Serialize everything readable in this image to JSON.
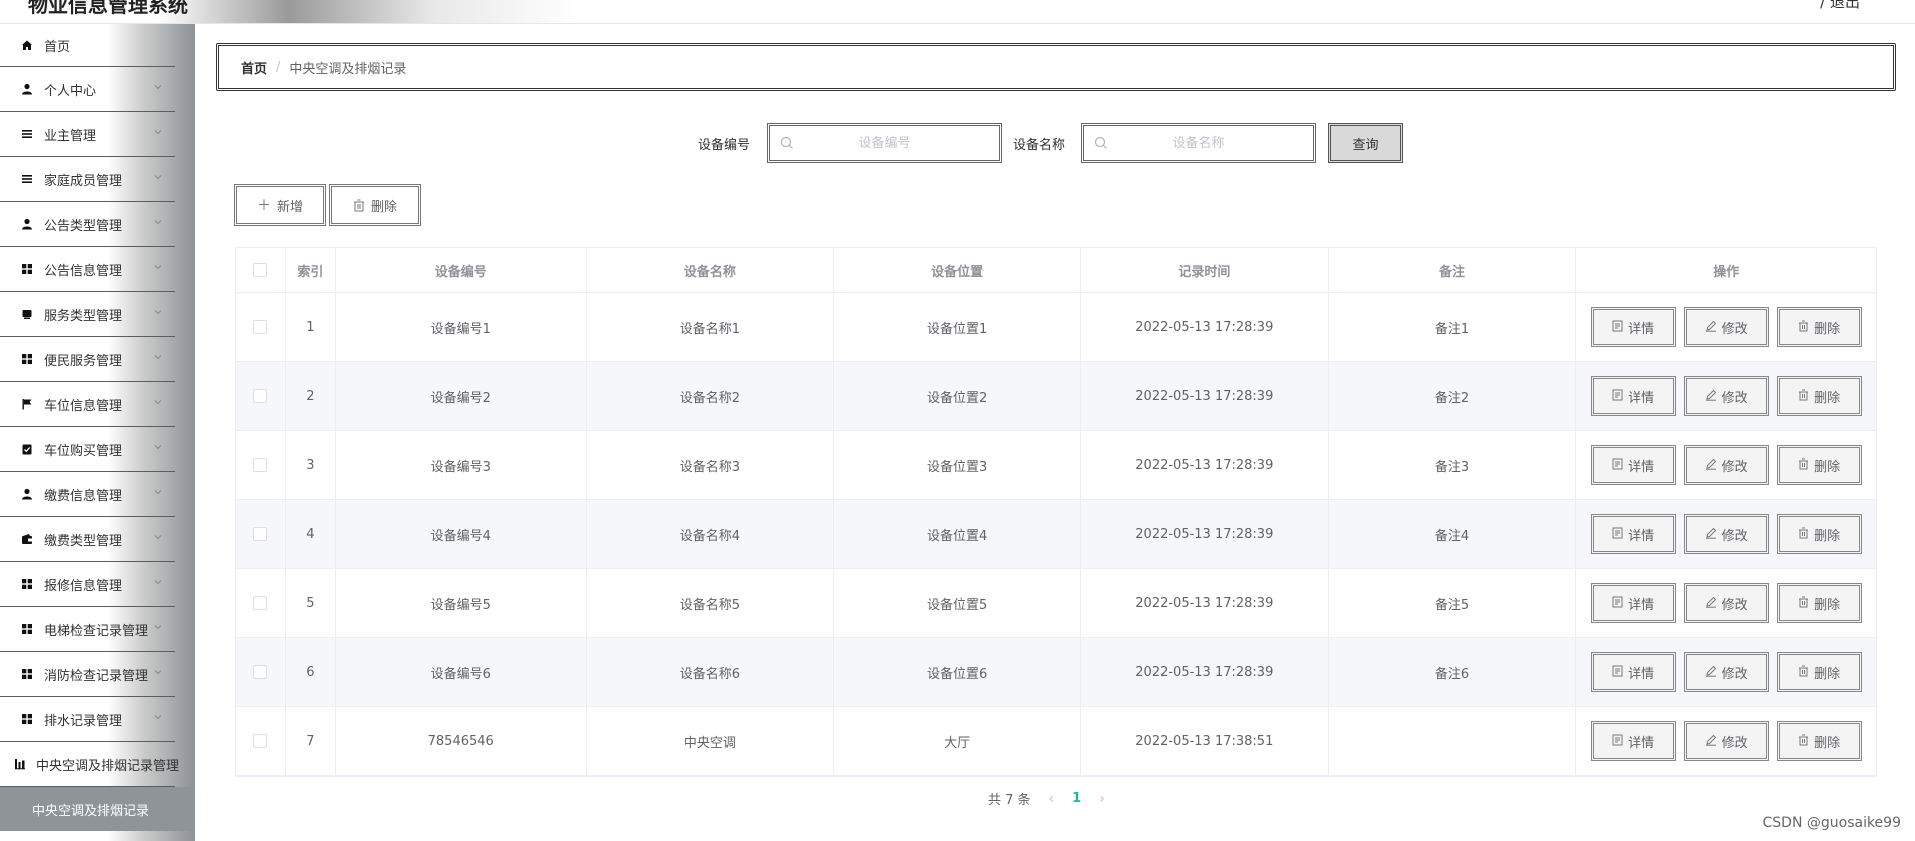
{
  "app": {
    "title": "物业信息管理系统",
    "top_right": "/ 退出"
  },
  "sidebar": {
    "items": [
      {
        "label": "首页",
        "icon": "home-icon"
      },
      {
        "label": "个人中心",
        "icon": "user-icon"
      },
      {
        "label": "业主管理",
        "icon": "list-icon"
      },
      {
        "label": "家庭成员管理",
        "icon": "list-icon"
      },
      {
        "label": "公告类型管理",
        "icon": "user-icon"
      },
      {
        "label": "公告信息管理",
        "icon": "grid-icon"
      },
      {
        "label": "服务类型管理",
        "icon": "box-icon"
      },
      {
        "label": "便民服务管理",
        "icon": "grid-icon"
      },
      {
        "label": "车位信息管理",
        "icon": "flag-icon"
      },
      {
        "label": "车位购买管理",
        "icon": "clipboard-icon"
      },
      {
        "label": "缴费信息管理",
        "icon": "user-icon"
      },
      {
        "label": "缴费类型管理",
        "icon": "wallet-icon"
      },
      {
        "label": "报修信息管理",
        "icon": "grid-icon"
      },
      {
        "label": "电梯检查记录管理",
        "icon": "grid-icon"
      },
      {
        "label": "消防检查记录管理",
        "icon": "grid-icon"
      },
      {
        "label": "排水记录管理",
        "icon": "grid-icon"
      },
      {
        "label": "中央空调及排烟记录管理",
        "icon": "chart-icon"
      }
    ],
    "active_sub": "中央空调及排烟记录"
  },
  "breadcrumb": {
    "home": "首页",
    "separator": "/",
    "current": "中央空调及排烟记录"
  },
  "search": {
    "code_label": "设备编号",
    "code_placeholder": "设备编号",
    "name_label": "设备名称",
    "name_placeholder": "设备名称",
    "query_label": "查询"
  },
  "actions": {
    "add_label": "新增",
    "delete_label": "删除"
  },
  "table": {
    "headers": [
      "索引",
      "设备编号",
      "设备名称",
      "设备位置",
      "记录时间",
      "备注",
      "操作"
    ],
    "op_labels": {
      "detail": "详情",
      "edit": "修改",
      "delete": "删除"
    },
    "rows": [
      [
        "1",
        "设备编号1",
        "设备名称1",
        "设备位置1",
        "2022-05-13 17:28:39",
        "备注1"
      ],
      [
        "2",
        "设备编号2",
        "设备名称2",
        "设备位置2",
        "2022-05-13 17:28:39",
        "备注2"
      ],
      [
        "3",
        "设备编号3",
        "设备名称3",
        "设备位置3",
        "2022-05-13 17:28:39",
        "备注3"
      ],
      [
        "4",
        "设备编号4",
        "设备名称4",
        "设备位置4",
        "2022-05-13 17:28:39",
        "备注4"
      ],
      [
        "5",
        "设备编号5",
        "设备名称5",
        "设备位置5",
        "2022-05-13 17:28:39",
        "备注5"
      ],
      [
        "6",
        "设备编号6",
        "设备名称6",
        "设备位置6",
        "2022-05-13 17:28:39",
        "备注6"
      ],
      [
        "7",
        "78546546",
        "中央空调",
        "大厅",
        "2022-05-13 17:38:51",
        ""
      ]
    ]
  },
  "pagination": {
    "total_text": "共 7 条",
    "current_page": "1"
  },
  "watermark": "CSDN @guosaike99",
  "colors": {
    "accent": "#1abc9c",
    "sidebar_active": "#8f9499"
  }
}
